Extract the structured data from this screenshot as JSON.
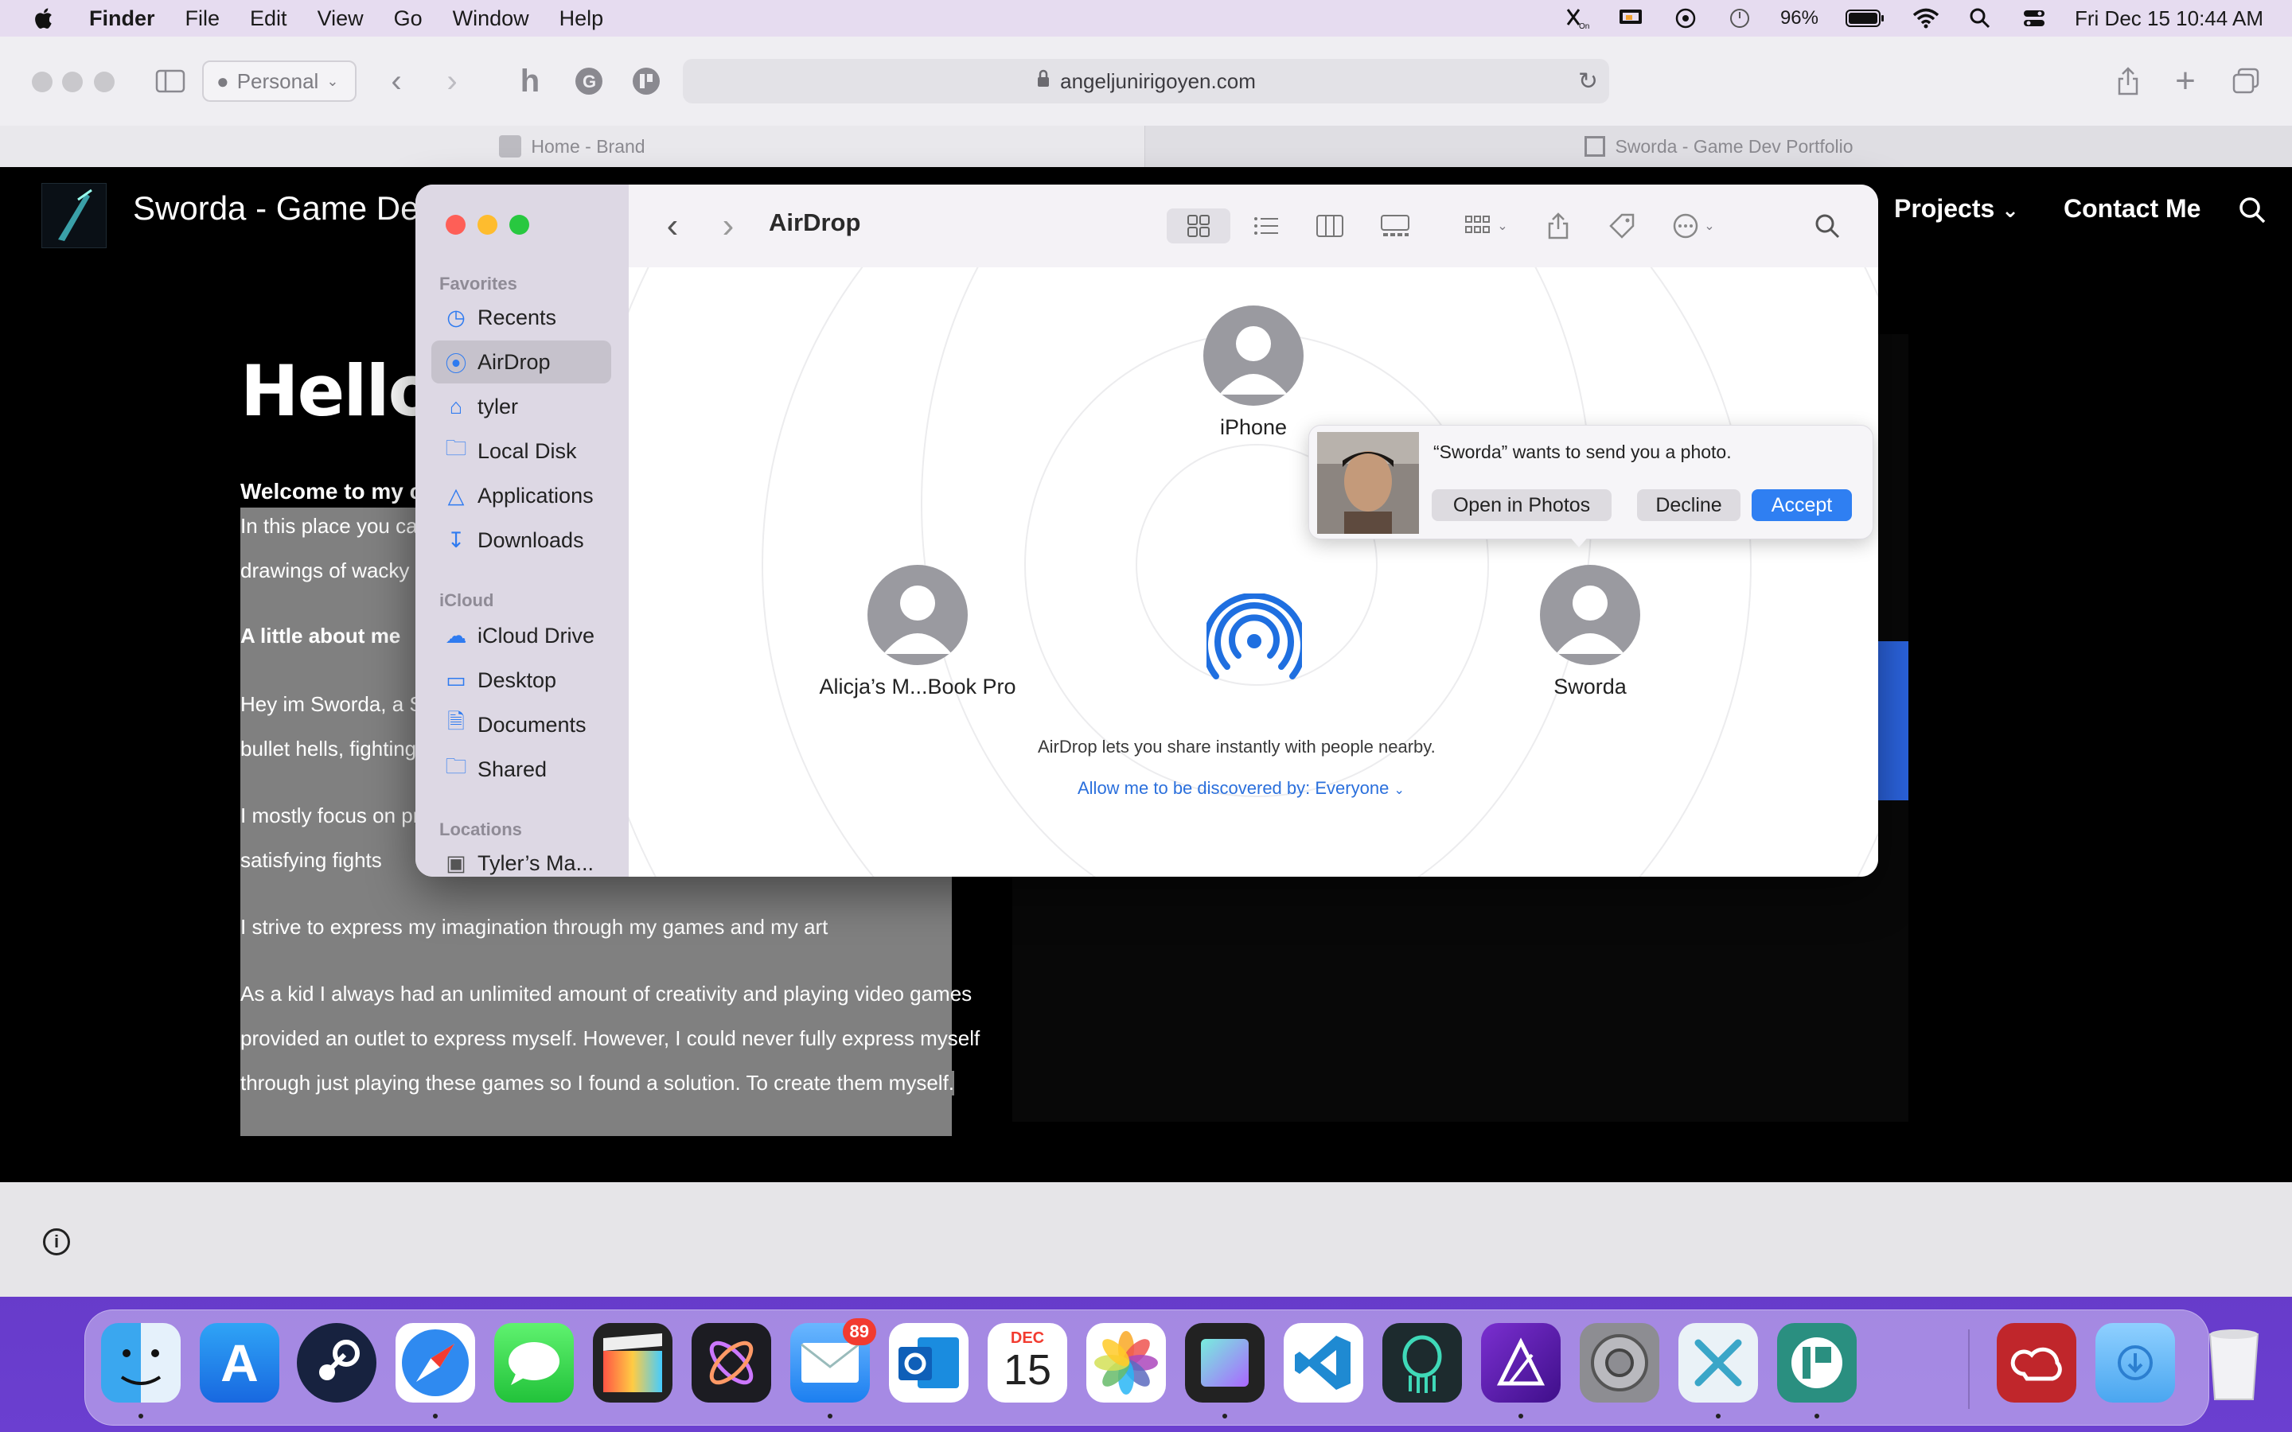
{
  "menubar": {
    "app": "Finder",
    "items": [
      "File",
      "Edit",
      "View",
      "Go",
      "Window",
      "Help"
    ],
    "battery": "96%",
    "datetime": "Fri Dec 15  10:44 AM"
  },
  "safari": {
    "profile": "Personal",
    "url": "angeljunirigoyen.com",
    "tabs": [
      "Home - Brand",
      "Sworda - Game Dev Portfolio"
    ]
  },
  "site": {
    "title": "Sworda - Game Dev",
    "nav": [
      "Projects",
      "Contact Me"
    ],
    "heading": "Hello",
    "welcome": "Welcome to my c",
    "lines": [
      "In this place you can v",
      "drawings of wacky sw",
      "A little about me",
      "Hey im Sworda, a Swe",
      "bullet hells, fighting g",
      "I mostly focus on prog",
      "satisfying fights",
      "I strive to express my imagination through my games and my art",
      "As a kid I always had an unlimited amount of creativity and playing video games",
      "provided an outlet to express myself. However, I could never fully express myself",
      "through just playing these games so I found a solution. To create them myself."
    ]
  },
  "finder": {
    "title": "AirDrop",
    "sidebar": {
      "favorites_header": "Favorites",
      "favorites": [
        "Recents",
        "AirDrop",
        "tyler",
        "Local Disk",
        "Applications",
        "Downloads"
      ],
      "icloud_header": "iCloud",
      "icloud": [
        "iCloud Drive",
        "Desktop",
        "Documents",
        "Shared"
      ],
      "locations_header": "Locations",
      "locations": [
        "Tyler’s Ma..."
      ]
    },
    "devices": [
      "iPhone",
      "Alicja’s M...Book Pro",
      "Sworda"
    ],
    "caption": "AirDrop lets you share instantly with people nearby.",
    "discover": "Allow me to be discovered by: Everyone",
    "popup": {
      "message": "“Sworda” wants to send you a photo.",
      "open": "Open in Photos",
      "decline": "Decline",
      "accept": "Accept"
    }
  },
  "dock": {
    "apps": [
      "Finder",
      "App Store",
      "Steam",
      "Safari",
      "Messages",
      "Final Cut Pro",
      "Motion",
      "Mail",
      "Outlook",
      "Calendar",
      "Photos",
      "Screens",
      "Visual Studio Code",
      "GitKraken",
      "Affinity Designer",
      "System Preferences",
      "Xcode Tools",
      "Klokki",
      "Creative Cloud",
      "Downloads",
      "Trash"
    ],
    "mail_badge": "89",
    "calendar_month": "DEC",
    "calendar_day": "15"
  },
  "colors": {
    "accent": "#2f7ff2",
    "airdrop_blue": "#1f6fe0"
  }
}
